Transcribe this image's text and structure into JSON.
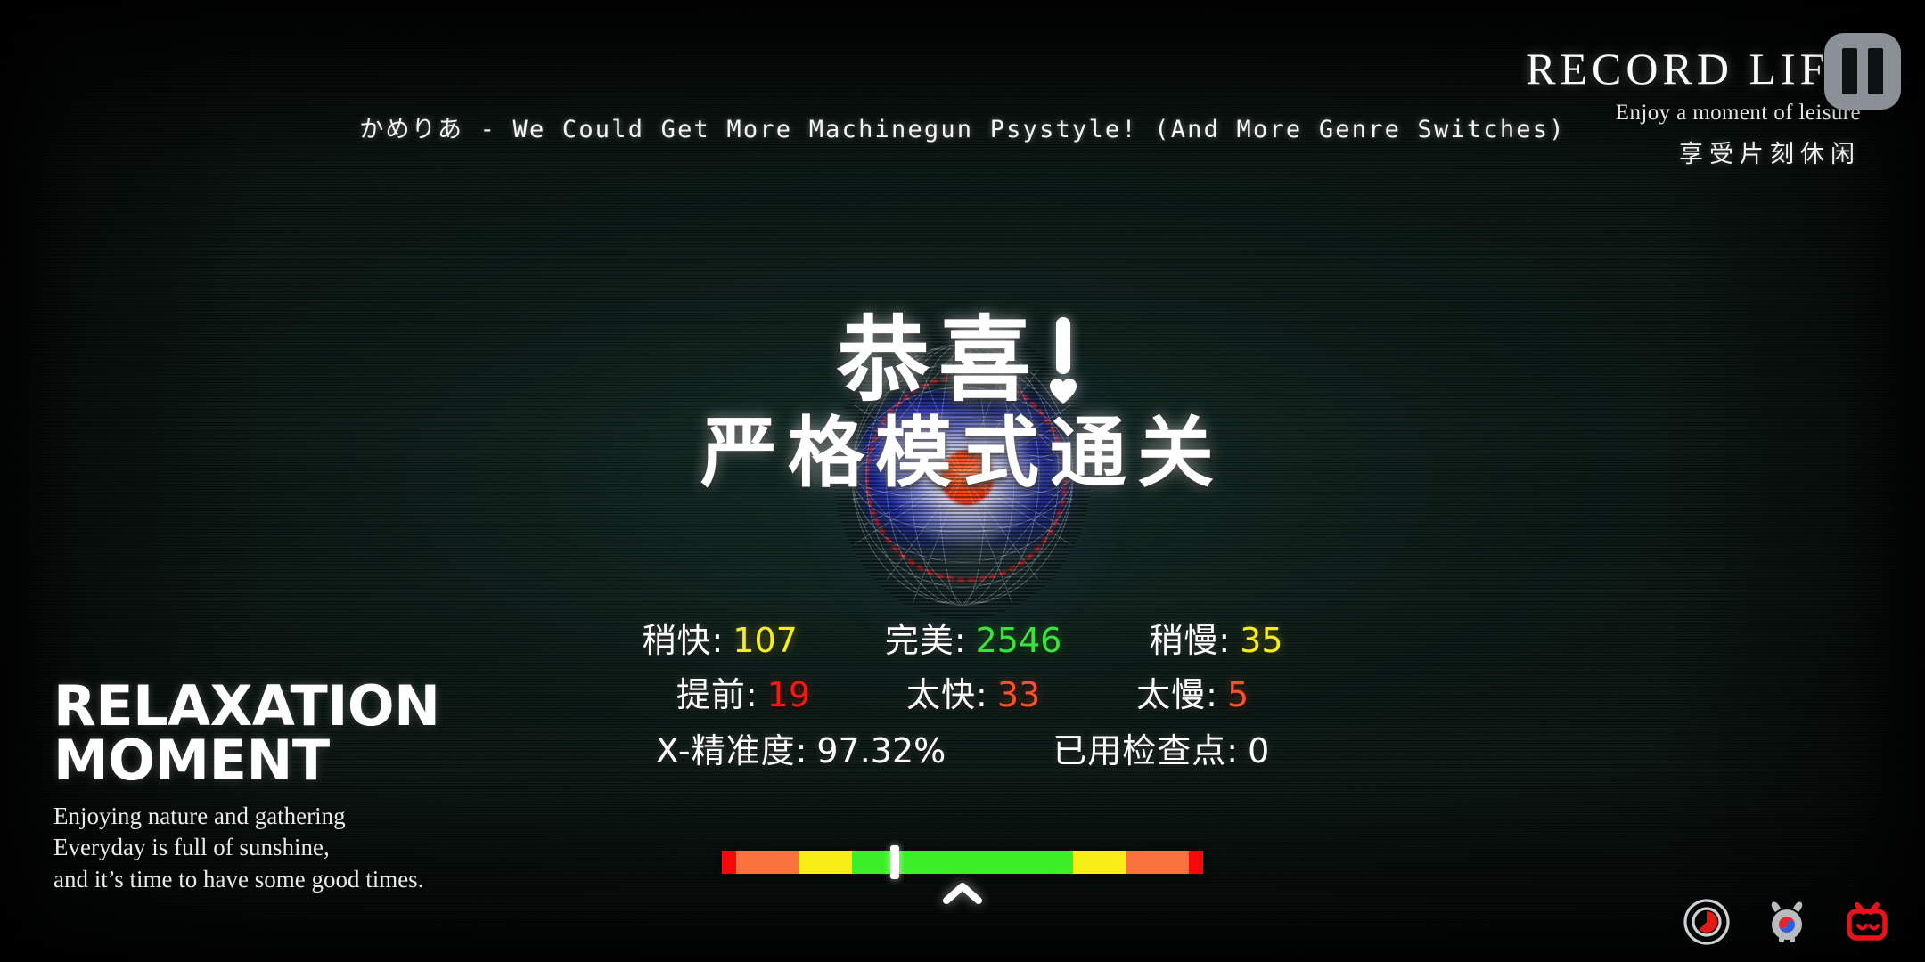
{
  "song": {
    "now_playing": "かめりあ - We Could Get More Machinegun Psystyle! (And More Genre Switches)"
  },
  "brand": {
    "title": "RECORD LIFE",
    "subtitle_en": "Enjoy a moment of leisure",
    "subtitle_cn": "享受片刻休闲"
  },
  "controls": {
    "pause_label": "pause"
  },
  "result": {
    "congrats": "恭喜",
    "mode_clear": "严格模式通关"
  },
  "stats": {
    "row1": [
      {
        "label": "稍快:",
        "value": "107",
        "color_class": "v-yellow",
        "color": "#f4ec23"
      },
      {
        "label": "完美:",
        "value": "2546",
        "color_class": "v-green",
        "color": "#3ce23c"
      },
      {
        "label": "稍慢:",
        "value": "35",
        "color_class": "v-yellow",
        "color": "#f4ec23"
      }
    ],
    "row2": [
      {
        "label": "提前:",
        "value": "19",
        "color_class": "v-red",
        "color": "#f21b12"
      },
      {
        "label": "太快:",
        "value": "33",
        "color_class": "v-orange",
        "color": "#f9512e"
      },
      {
        "label": "太慢:",
        "value": "5",
        "color_class": "v-orange",
        "color": "#f9512e"
      }
    ],
    "row3": [
      {
        "label": "X-精准度:",
        "value": "97.32%",
        "color_class": "v-white",
        "color": "#ffffff"
      },
      {
        "label": "已用检查点:",
        "value": "0",
        "color_class": "v-white",
        "color": "#ffffff"
      }
    ]
  },
  "relaxation": {
    "title_line1": "RELAXATION",
    "title_line2": "MOMENT",
    "body_line1": "Enjoying nature and gathering",
    "body_line2": "Everyday is full of sunshine,",
    "body_line3": "and it’s time to have some good times."
  },
  "timing_bar": {
    "marker_percent": 36,
    "segments": [
      {
        "name": "far-early",
        "color": "#f50a0a",
        "width_percent": 3
      },
      {
        "name": "early",
        "color": "#f9713c",
        "width_percent": 13
      },
      {
        "name": "slightly-early",
        "color": "#f8ee16",
        "width_percent": 11
      },
      {
        "name": "perfect",
        "color": "#3bee28",
        "width_percent": 46
      },
      {
        "name": "slightly-late",
        "color": "#f8ee16",
        "width_percent": 11
      },
      {
        "name": "late",
        "color": "#f9713c",
        "width_percent": 13
      },
      {
        "name": "far-late",
        "color": "#f50a0a",
        "width_percent": 3
      }
    ]
  },
  "tray": {
    "icons": [
      {
        "name": "record-icon",
        "color": "#e01a16"
      },
      {
        "name": "alarm-clock-icon",
        "color": "#b9bcbe"
      },
      {
        "name": "bilibili-tv-icon",
        "color": "#e5131a"
      }
    ]
  }
}
